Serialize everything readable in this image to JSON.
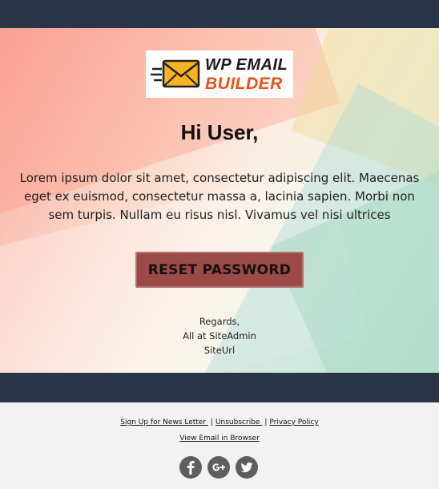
{
  "colors": {
    "bar": "#283447",
    "button_bg": "#9b4a47",
    "footer_bg": "#f2f2f2",
    "logo_accent": "#e8521a",
    "social_icon": "#5e5e5e"
  },
  "logo": {
    "line1": "WP EMAIL",
    "line2": "BUILDER",
    "icon": "envelope-icon"
  },
  "email": {
    "greeting": "Hi User,",
    "body": "Lorem ipsum dolor sit amet, consectetur adipiscing elit. Maecenas eget ex euismod, consectetur massa a, lacinia sapien. Morbi non sem turpis. Nullam eu risus nisl. Vivamus vel nisi ultrices",
    "button_label": "RESET PASSWORD",
    "signoff": {
      "line1": "Regards,",
      "line2": "All at SiteAdmin",
      "line3": "SiteUrl"
    }
  },
  "footer": {
    "links": [
      {
        "label": "Sign Up for News Letter "
      },
      {
        "label": "Unsubscribe "
      },
      {
        "label": "Privacy Policy"
      }
    ],
    "separator": "|",
    "view_in_browser": "View Email in Browser",
    "social": [
      {
        "name": "facebook-icon",
        "glyph": "f"
      },
      {
        "name": "google-plus-icon",
        "glyph": "G+"
      },
      {
        "name": "twitter-icon",
        "glyph": "bird"
      }
    ]
  }
}
